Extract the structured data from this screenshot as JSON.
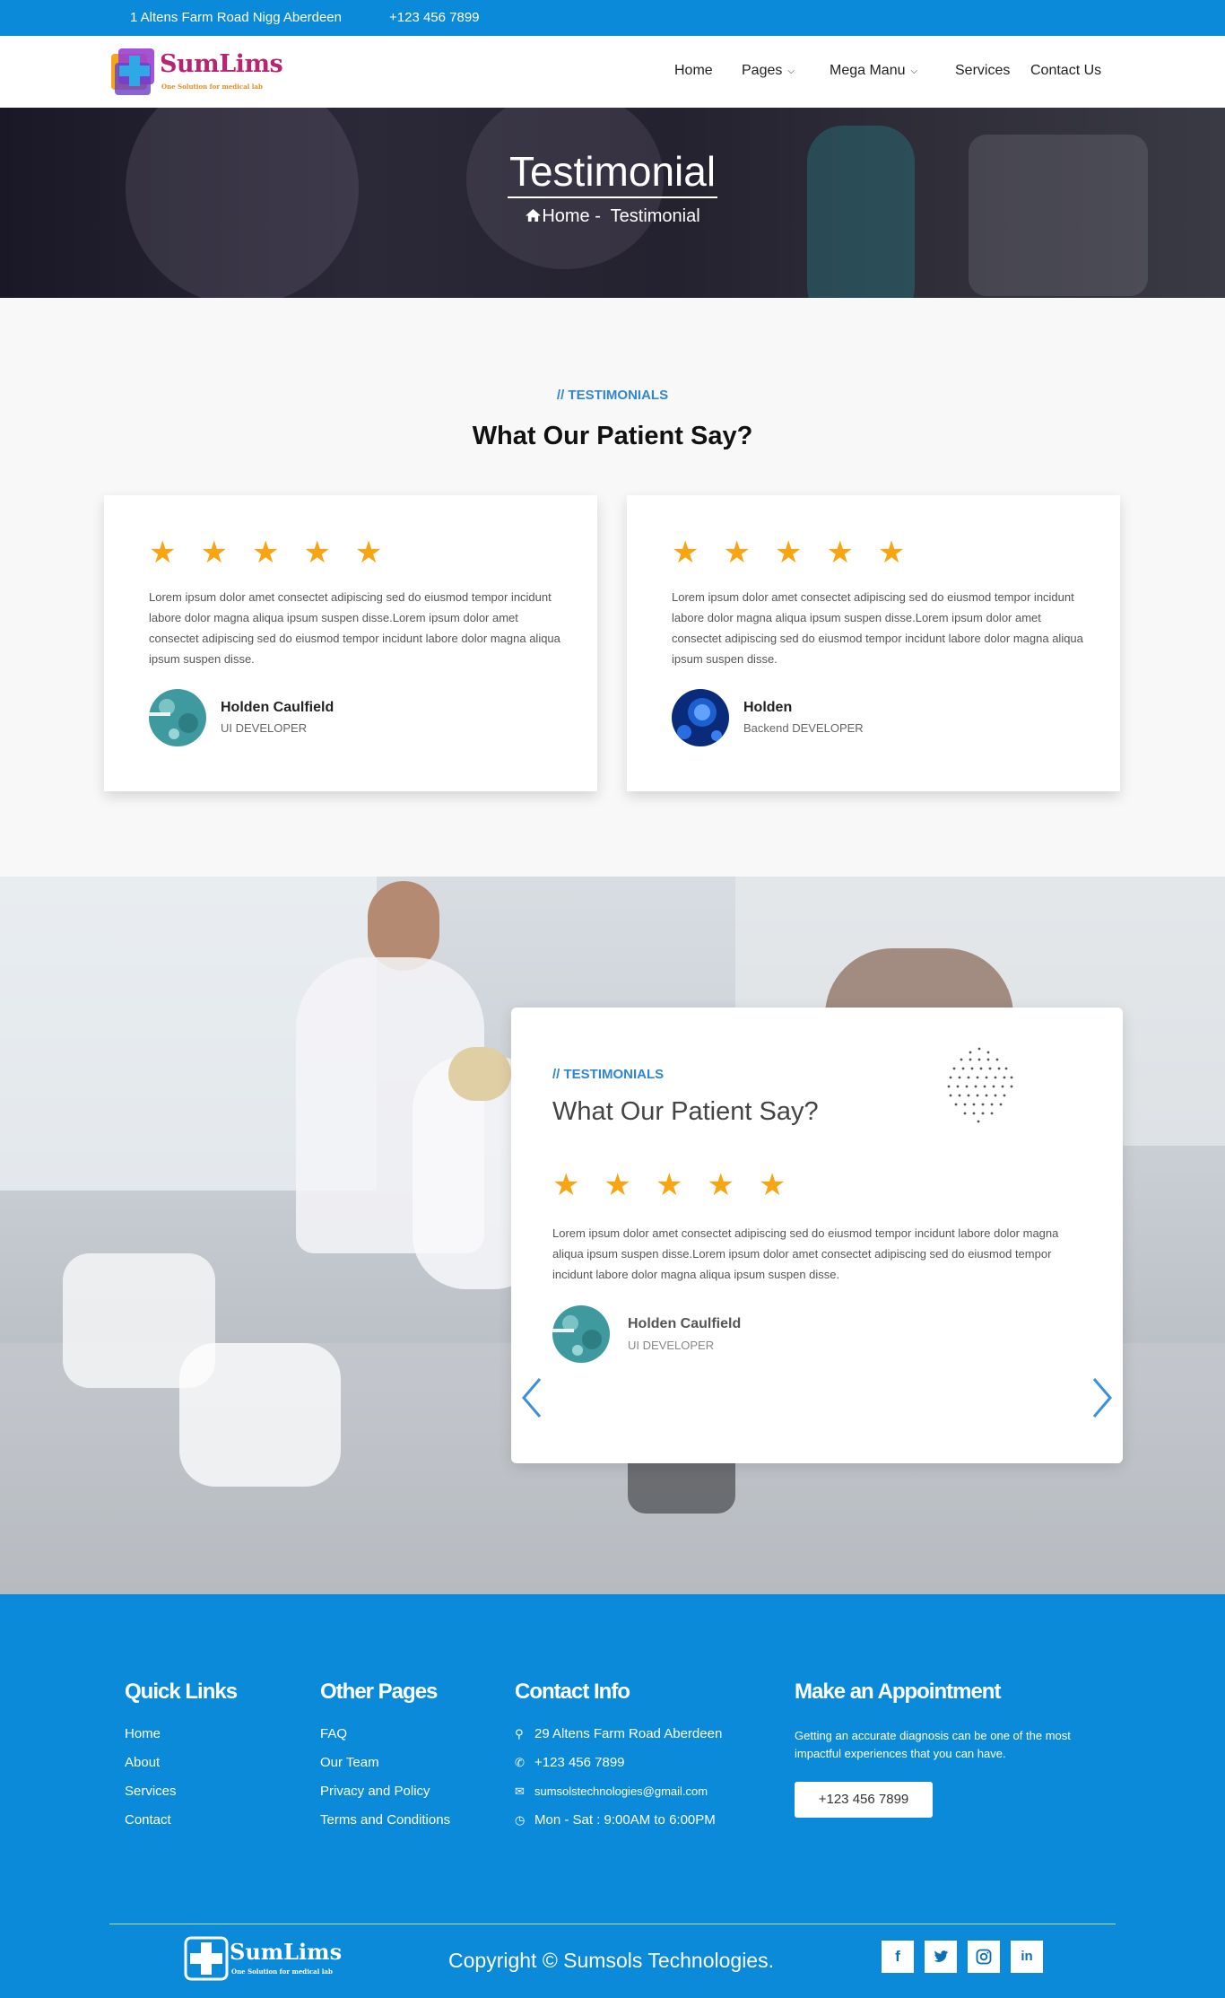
{
  "topbar": {
    "address": "1 Altens Farm Road Nigg Aberdeen",
    "phone": "+123 456 7899"
  },
  "brand": {
    "name": "SumLims",
    "tagline": "One Solution for medical lab"
  },
  "nav": {
    "home": "Home",
    "pages": "Pages",
    "mega": "Mega Manu",
    "services": "Services",
    "contact": "Contact Us"
  },
  "hero": {
    "title": "Testimonial",
    "crumb_home": "Home",
    "crumb_sep": " -  ",
    "crumb_current": "Testimonial"
  },
  "testimonials": {
    "eyebrow": "// TESTIMONIALS",
    "title": "What Our Patient Say?",
    "stars": "★★★★★",
    "items": [
      {
        "text": "Lorem ipsum dolor amet consectet adipiscing sed do eiusmod tempor incidunt labore dolor magna aliqua ipsum suspen disse.Lorem ipsum dolor amet consectet adipiscing sed do eiusmod tempor incidunt labore dolor magna aliqua ipsum suspen disse.",
        "name": "Holden Caulfield",
        "role": "UI DEVELOPER"
      },
      {
        "text": "Lorem ipsum dolor amet consectet adipiscing sed do eiusmod tempor incidunt labore dolor magna aliqua ipsum suspen disse.Lorem ipsum dolor amet consectet adipiscing sed do eiusmod tempor incidunt labore dolor magna aliqua ipsum suspen disse.",
        "name": "Holden",
        "role": "Backend DEVELOPER"
      }
    ]
  },
  "slider": {
    "eyebrow": "// TESTIMONIALS",
    "title": "What Our Patient Say?",
    "stars": "★★★★★",
    "text": "Lorem ipsum dolor amet consectet adipiscing sed do eiusmod tempor incidunt labore dolor magna aliqua ipsum suspen disse.Lorem ipsum dolor amet consectet adipiscing sed do eiusmod tempor incidunt labore dolor magna aliqua ipsum suspen disse.",
    "name": "Holden Caulfield",
    "role": "UI DEVELOPER"
  },
  "footer": {
    "quick_title": "Quick Links",
    "quick": [
      "Home",
      "About",
      "Services",
      "Contact"
    ],
    "other_title": "Other Pages",
    "other": [
      "FAQ",
      "Our Team",
      "Privacy and Policy",
      "Terms and Conditions"
    ],
    "contact_title": "Contact Info",
    "contact": {
      "address": "29 Altens Farm Road Aberdeen",
      "phone": "+123 456 7899",
      "email": "sumsolstechnologies@gmail.com",
      "hours": "Mon - Sat : 9:00AM to 6:00PM"
    },
    "appt_title": "Make an Appointment",
    "appt_desc": "Getting an accurate diagnosis can be one of the most impactful experiences that you can have.",
    "appt_button": "+123 456 7899",
    "copyright": "Copyright © Sumsols Technologies.",
    "social": [
      "facebook-icon",
      "twitter-icon",
      "instagram-icon",
      "linkedin-icon"
    ]
  },
  "colors": {
    "primary": "#0b8ad9",
    "star": "#f7a513",
    "accent": "#2f86d4"
  }
}
